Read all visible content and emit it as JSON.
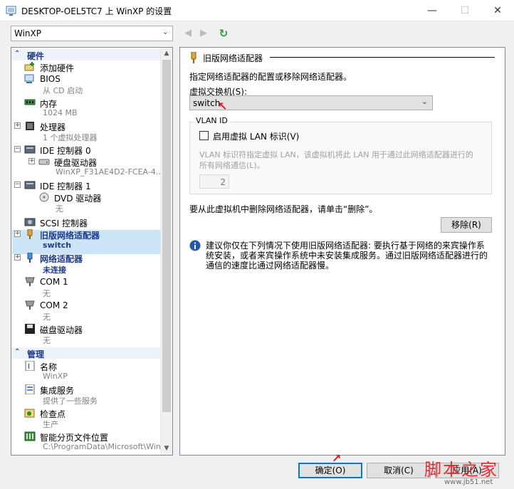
{
  "window": {
    "title": "DESKTOP-OEL5TC7 上 WinXP 的设置",
    "minimize": "—",
    "maximize": "☐",
    "close": "✕"
  },
  "vm_selector": {
    "value": "WinXP"
  },
  "nav": {
    "back": "◀",
    "forward": "▶",
    "refresh": "↻"
  },
  "tree": {
    "hardware_header": "硬件",
    "management_header": "管理",
    "items": [
      {
        "label": "添加硬件",
        "sub": ""
      },
      {
        "label": "BIOS",
        "sub": "从 CD 启动"
      },
      {
        "label": "内存",
        "sub": "1024 MB"
      },
      {
        "label": "处理器",
        "sub": "1 个虚拟处理器"
      },
      {
        "label": "IDE 控制器 0",
        "sub": ""
      },
      {
        "label": "硬盘驱动器",
        "sub": "WinXP_F31AE4D2-FCEA-4..."
      },
      {
        "label": "IDE 控制器 1",
        "sub": ""
      },
      {
        "label": "DVD 驱动器",
        "sub": "无"
      },
      {
        "label": "SCSI 控制器",
        "sub": ""
      },
      {
        "label": "旧版网络适配器",
        "sub": "switch"
      },
      {
        "label": "网络适配器",
        "sub": "未连接"
      },
      {
        "label": "COM 1",
        "sub": "无"
      },
      {
        "label": "COM 2",
        "sub": "无"
      },
      {
        "label": "磁盘驱动器",
        "sub": "无"
      },
      {
        "label": "名称",
        "sub": "WinXP"
      },
      {
        "label": "集成服务",
        "sub": "提供了一些服务"
      },
      {
        "label": "检查点",
        "sub": "生产"
      },
      {
        "label": "智能分页文件位置",
        "sub": "C:\\ProgramData\\Microsoft\\Win..."
      }
    ]
  },
  "panel": {
    "heading": "旧版网络适配器",
    "description": "指定网络适配器的配置或移除网络适配器。",
    "switch_label": "虚拟交换机(S):",
    "switch_value": "switch",
    "vlan_title": "VLAN ID",
    "vlan_checkbox": "启用虚拟 LAN 标识(V)",
    "vlan_desc_1": "VLAN 标识符指定虚拟 LAN，该虚拟机将此 LAN 用于通过此网络适配器进行的",
    "vlan_desc_2": "所有网络通信(L)。",
    "vlan_value": "2",
    "remove_text": "要从此虚拟机中删除网络适配器，请单击“删除”。",
    "remove_button": "移除(R)",
    "info_1": "建议你仅在下列情况下使用旧版网络适配器: 要执行基于网络的来宾操作系",
    "info_2": "统安装，或者来宾操作系统中未安装集成服务。通过旧版网络适配器进行的",
    "info_3": "通信的速度比通过网络适配器慢。"
  },
  "buttons": {
    "ok": "确定(O)",
    "cancel": "取消(C)",
    "apply": "应用(A)"
  },
  "watermark": {
    "text": "脚本之家",
    "url": "www.jb51.net"
  },
  "colors": {
    "accent": "#0078d7",
    "tree_header": "#1e3a8a",
    "selection": "#cce4f7",
    "annotation_arrow": "#e81123"
  }
}
